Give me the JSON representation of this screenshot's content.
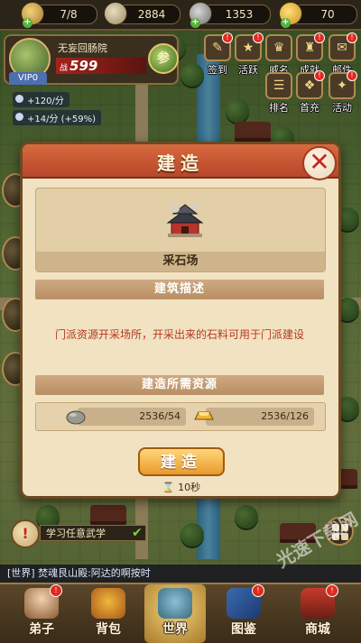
{
  "resources": [
    {
      "icon": "meat-icon",
      "value": "7/8"
    },
    {
      "icon": "scroll-icon",
      "value": "2884"
    },
    {
      "icon": "coin-icon",
      "value": "1353"
    },
    {
      "icon": "gold-ingot-icon",
      "value": "70"
    }
  ],
  "profile": {
    "sect_name": "无妄回肠院",
    "power_label": "战",
    "power": "599",
    "vip": "VIP0",
    "badge": "参"
  },
  "income": [
    "+120/分",
    "+14/分 (+59%)"
  ],
  "menu": {
    "row1": [
      {
        "label": "签到",
        "badge": true
      },
      {
        "label": "活跃",
        "badge": true
      },
      {
        "label": "威名",
        "badge": false
      },
      {
        "label": "成就",
        "badge": true
      },
      {
        "label": "邮件",
        "badge": true
      }
    ],
    "row2": [
      {
        "label": "排名",
        "badge": false
      },
      {
        "label": "首充",
        "badge": true
      },
      {
        "label": "活动",
        "badge": true
      }
    ]
  },
  "dialog": {
    "title": "建造",
    "close_symbol": "✕",
    "building_name": "采石场",
    "desc_header": "建筑描述",
    "description": "门派资源开采场所，开采出来的石料可用于门派建设",
    "req_header": "建造所需资源",
    "requirements": [
      {
        "icon": "stone-icon",
        "value": "2536/54"
      },
      {
        "icon": "gold-ingot-icon",
        "value": "2536/126"
      }
    ],
    "build_label": "建造",
    "timer": "10秒"
  },
  "quest": {
    "text": "学习任意武学",
    "icon_symbol": "!"
  },
  "chat": "[世界] 焚魂艮山殿:阿达的啊按时",
  "nav": [
    {
      "label": "弟子",
      "badge": true,
      "active": false
    },
    {
      "label": "背包",
      "badge": false,
      "active": false
    },
    {
      "label": "世界",
      "badge": false,
      "active": true
    },
    {
      "label": "图鉴",
      "badge": true,
      "active": false
    },
    {
      "label": "商城",
      "badge": true,
      "active": false
    }
  ],
  "watermark": "光速下载网",
  "colors": {
    "dialog_header": "#c0502f",
    "dialog_body": "#f1e2c2",
    "description_text": "#b7391e",
    "build_button": "#f0b04a",
    "badge_red": "#e02a1e"
  }
}
